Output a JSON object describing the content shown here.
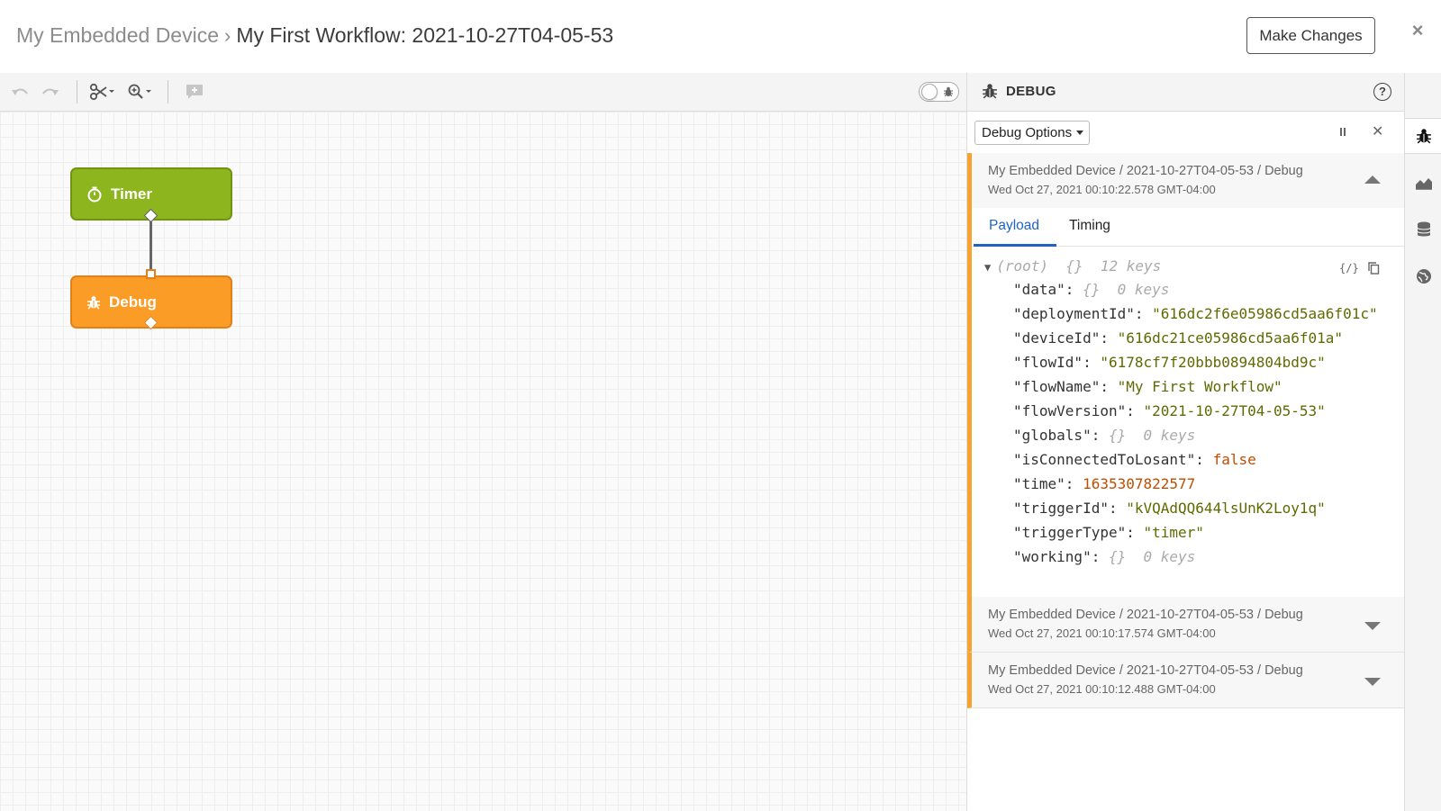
{
  "header": {
    "breadcrumb_parent": "My Embedded Device",
    "breadcrumb_separator": "›",
    "breadcrumb_current": "My First Workflow: 2021-10-27T04-05-53",
    "make_changes_label": "Make Changes",
    "close_label": "×"
  },
  "toolbar": {
    "icons": [
      "undo-icon",
      "redo-icon",
      "scissors-icon",
      "zoom-icon",
      "comment-icon",
      "debug-toggle"
    ]
  },
  "canvas": {
    "nodes": [
      {
        "label": "Timer",
        "icon": "timer-icon",
        "color": "#8db61e"
      },
      {
        "label": "Debug",
        "icon": "bug-icon",
        "color": "#fb9c27"
      }
    ]
  },
  "debug": {
    "title": "DEBUG",
    "options_label": "Debug Options",
    "messages": [
      {
        "path": "My Embedded Device / 2021-10-27T04-05-53 / Debug",
        "time": "Wed Oct 27, 2021 00:10:22.578 GMT-04:00",
        "expanded": true
      },
      {
        "path": "My Embedded Device / 2021-10-27T04-05-53 / Debug",
        "time": "Wed Oct 27, 2021 00:10:17.574 GMT-04:00",
        "expanded": false
      },
      {
        "path": "My Embedded Device / 2021-10-27T04-05-53 / Debug",
        "time": "Wed Oct 27, 2021 00:10:12.488 GMT-04:00",
        "expanded": false
      }
    ],
    "tabs": {
      "payload": "Payload",
      "timing": "Timing"
    },
    "payload": {
      "root_label": "(root)",
      "root_braces": "{}",
      "root_count": "12 keys",
      "lines": [
        {
          "key": "\"data\":",
          "value": "{}",
          "meta": "0 keys",
          "type": "object"
        },
        {
          "key": "\"deploymentId\":",
          "value": "\"616dc2f6e05986cd5aa6f01c\"",
          "type": "string"
        },
        {
          "key": "\"deviceId\":",
          "value": "\"616dc21ce05986cd5aa6f01a\"",
          "type": "string"
        },
        {
          "key": "\"flowId\":",
          "value": "\"6178cf7f20bbb0894804bd9c\"",
          "type": "string"
        },
        {
          "key": "\"flowName\":",
          "value": "\"My First Workflow\"",
          "type": "string"
        },
        {
          "key": "\"flowVersion\":",
          "value": "\"2021-10-27T04-05-53\"",
          "type": "string"
        },
        {
          "key": "\"globals\":",
          "value": "{}",
          "meta": "0 keys",
          "type": "object"
        },
        {
          "key": "\"isConnectedToLosant\":",
          "value": "false",
          "type": "boolean"
        },
        {
          "key": "\"time\":",
          "value": "1635307822577",
          "type": "number"
        },
        {
          "key": "\"triggerId\":",
          "value": "\"kVQAdQQ644lsUnK2Loy1q\"",
          "type": "string"
        },
        {
          "key": "\"triggerType\":",
          "value": "\"timer\"",
          "type": "string"
        },
        {
          "key": "\"working\":",
          "value": "{}",
          "meta": "0 keys",
          "type": "object"
        }
      ]
    }
  },
  "rail": {
    "icons": [
      "bug-icon",
      "chart-icon",
      "database-icon",
      "globe-icon"
    ]
  },
  "colors": {
    "accent_blue": "#1f63c6",
    "timer_green": "#8db61e",
    "debug_orange": "#fb9c27",
    "message_border": "#f7a331"
  }
}
